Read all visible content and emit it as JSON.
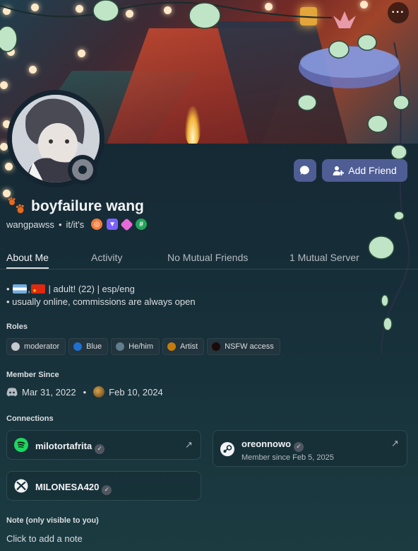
{
  "colors": {
    "background": "#17303a",
    "button": "#4e5d94",
    "accent_text": "#f2f3f5",
    "status_offline": "#80848e"
  },
  "header": {
    "more_icon": "more-dots-icon",
    "more_label": "···"
  },
  "actions": {
    "message_icon": "chat-bubble-icon",
    "add_friend_label": "Add Friend",
    "add_friend_icon": "add-user-icon"
  },
  "profile": {
    "display_name": "boyfailure wang",
    "name_icon": "paw-prints-icon",
    "username": "wangpawss",
    "separator": "•",
    "pronouns": "it/it's",
    "status": "offline"
  },
  "tabs": [
    {
      "label": "About Me",
      "active": true
    },
    {
      "label": "Activity",
      "active": false
    },
    {
      "label": "No Mutual Friends",
      "active": false
    },
    {
      "label": "1 Mutual Server",
      "active": false
    }
  ],
  "bio": {
    "line1_prefix": "•",
    "line1_suffix": "| adult! (22) | esp/eng",
    "line2": "• usually online, commissions are always open"
  },
  "roles": {
    "title": "Roles",
    "items": [
      {
        "label": "moderator",
        "color": "#c4c9ce"
      },
      {
        "label": "Blue",
        "color": "#1f6fd1"
      },
      {
        "label": "He/him",
        "color": "#607d8b"
      },
      {
        "label": "Artist",
        "color": "#c27c0e"
      },
      {
        "label": "NSFW access",
        "color": "#1a0a0a"
      }
    ]
  },
  "member_since": {
    "title": "Member Since",
    "discord_date": "Mar 31, 2022",
    "separator": "•",
    "server_date": "Feb 10, 2024"
  },
  "connections": {
    "title": "Connections",
    "items": [
      {
        "service": "spotify",
        "name": "milotortafrita",
        "sub": ""
      },
      {
        "service": "steam",
        "name": "oreonnowo",
        "sub": "Member since Feb 5, 2025"
      },
      {
        "service": "xbox",
        "name": "MILONESA420",
        "sub": ""
      }
    ]
  },
  "note": {
    "title": "Note (only visible to you)",
    "placeholder": "Click to add a note"
  }
}
